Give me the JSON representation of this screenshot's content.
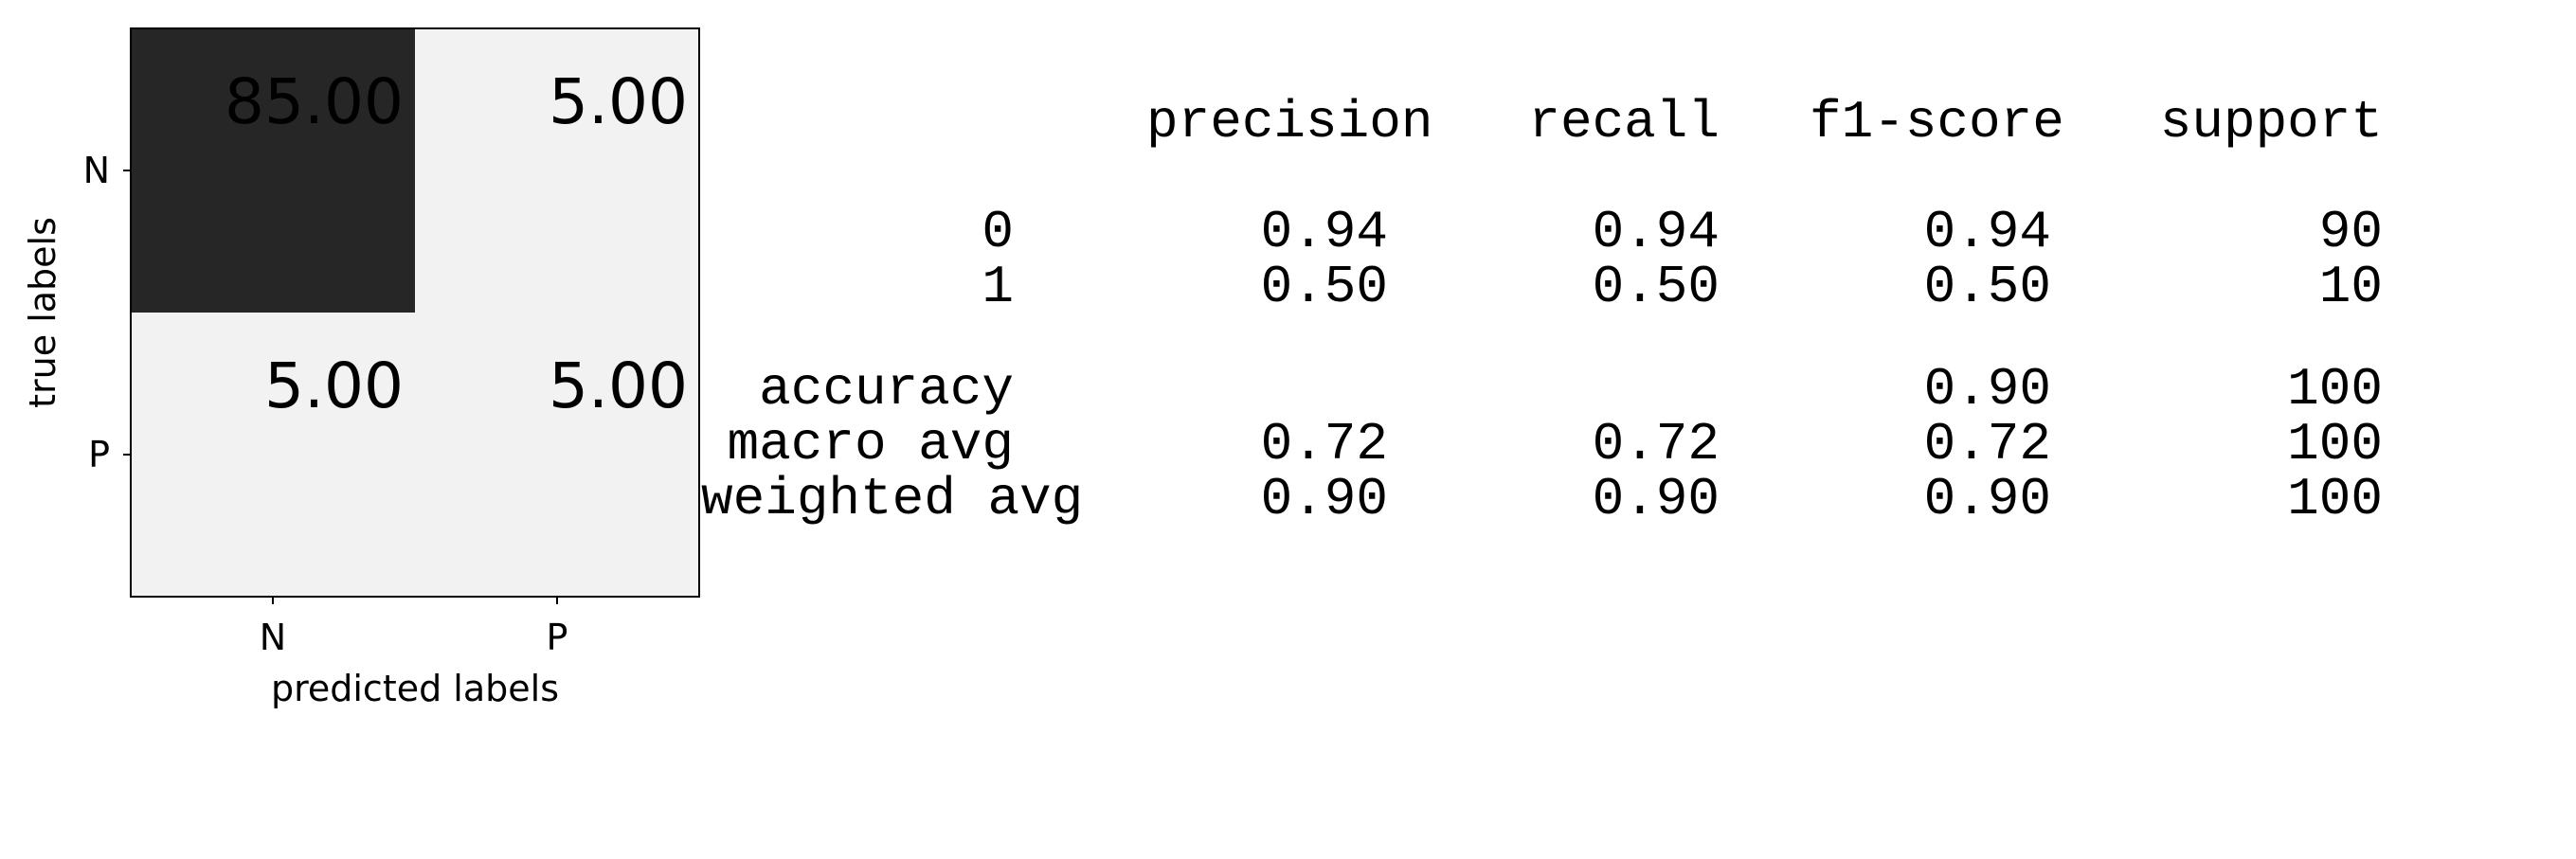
{
  "chart_data": [
    {
      "type": "heatmap",
      "xlabel": "predicted labels",
      "ylabel": "true labels",
      "x_categories": [
        "N",
        "P"
      ],
      "y_categories": [
        "N",
        "P"
      ],
      "values": [
        [
          85.0,
          5.0
        ],
        [
          5.0,
          5.0
        ]
      ],
      "cell_labels": [
        [
          "85.00",
          "5.00"
        ],
        [
          "5.00",
          "5.00"
        ]
      ],
      "colormap": {
        "low": "#f2f2f2",
        "high": "#262626"
      },
      "text_colors": {
        "on_dark": "#ffffff",
        "on_light": "#000000"
      }
    },
    {
      "type": "table",
      "columns": [
        "",
        "precision",
        "recall",
        "f1-score",
        "support"
      ],
      "rows": [
        {
          "label": "0",
          "precision": "0.94",
          "recall": "0.94",
          "f1": "0.94",
          "support": "90"
        },
        {
          "label": "1",
          "precision": "0.50",
          "recall": "0.50",
          "f1": "0.50",
          "support": "10"
        },
        {
          "label": "accuracy",
          "precision": "",
          "recall": "",
          "f1": "0.90",
          "support": "100"
        },
        {
          "label": "macro avg",
          "precision": "0.72",
          "recall": "0.72",
          "f1": "0.72",
          "support": "100"
        },
        {
          "label": "weighted avg",
          "precision": "0.90",
          "recall": "0.90",
          "f1": "0.90",
          "support": "100"
        }
      ]
    }
  ]
}
